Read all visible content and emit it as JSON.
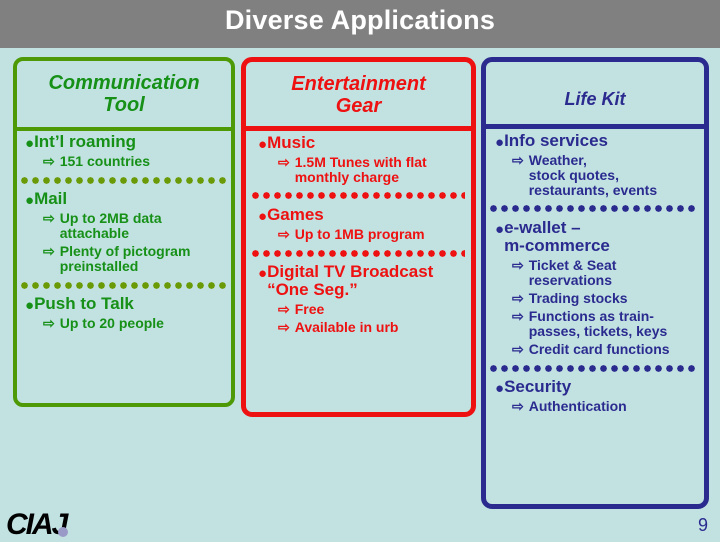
{
  "slide": {
    "title": "Diverse Applications",
    "page_number": "9",
    "title_band_color": "#808080",
    "background_color": "#c2e2e2"
  },
  "logo": {
    "text": "CIAJ",
    "dot_color": "#9a9ac8",
    "text_color": "#000000"
  },
  "columns": [
    {
      "id": "communication",
      "header": "Communication\nTool",
      "color": "#169016",
      "border_color": "#4e9a06",
      "groups": [
        {
          "bullet": "Int’l roaming",
          "subs": [
            "151 countries"
          ]
        },
        {
          "bullet": "Mail",
          "subs": [
            "Up to 2MB data\nattachable",
            "Plenty of pictogram\npreinstalled"
          ]
        },
        {
          "bullet": "Push to Talk",
          "subs": [
            "Up to 20 people"
          ]
        }
      ]
    },
    {
      "id": "entertainment",
      "header": "Entertainment\nGear",
      "color": "#ee1111",
      "border_color": "#ee1111",
      "groups": [
        {
          "bullet": "Music",
          "subs": [
            "1.5M Tunes with flat\nmonthly charge"
          ]
        },
        {
          "bullet": "Games",
          "subs": [
            "Up to 1MB program"
          ]
        },
        {
          "bullet": "Digital TV Broadcast\n“One Seg.”",
          "subs": [
            "Free",
            "Available in urb"
          ]
        }
      ]
    },
    {
      "id": "lifekit",
      "header": "Life Kit",
      "color": "#2b2b8f",
      "border_color": "#2b2b8f",
      "groups": [
        {
          "bullet": "Info services",
          "subs": [
            "Weather,\nstock quotes,\nrestaurants, events"
          ]
        },
        {
          "bullet": "e-wallet –\nm-commerce",
          "subs": [
            "Ticket & Seat\nreservations",
            "Trading stocks",
            "Functions as train-\npasses, tickets, keys",
            "Credit card functions"
          ]
        },
        {
          "bullet": "Security",
          "subs": [
            "Authentication"
          ]
        }
      ]
    }
  ],
  "glyphs": {
    "bullet_dot": "●",
    "sub_arrow": "⇨"
  }
}
